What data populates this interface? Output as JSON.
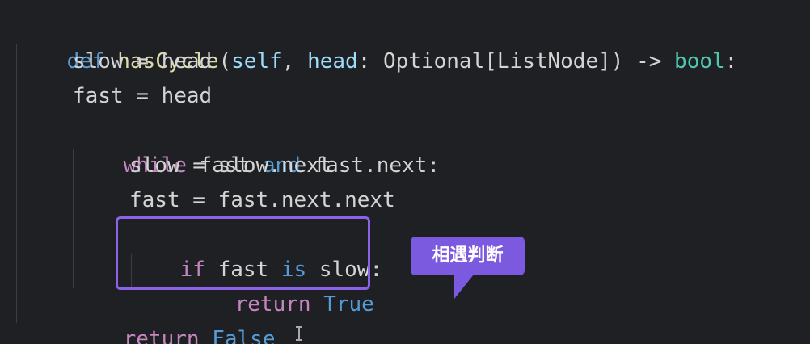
{
  "editor": {
    "partial_line": "s Solution:",
    "lines": [
      {
        "tokens": [
          "def",
          " ",
          "hasCycle",
          "(",
          "self",
          ", ",
          "head",
          ": Optional[ListNode]) -> ",
          "bool",
          ":"
        ]
      },
      {
        "text": "slow = head"
      },
      {
        "text": "fast = head"
      },
      {
        "tokens": [
          "while",
          " fast ",
          "and",
          " fast.next:"
        ]
      },
      {
        "text": "slow = slow.next"
      },
      {
        "text": "fast = fast.next.next"
      },
      {
        "tokens": [
          "if",
          " fast ",
          "is",
          " slow:"
        ]
      },
      {
        "tokens": [
          "return",
          " ",
          "True"
        ]
      },
      {
        "tokens": [
          "return",
          " ",
          "False"
        ]
      }
    ]
  },
  "callout": {
    "label": "相遇判断"
  }
}
